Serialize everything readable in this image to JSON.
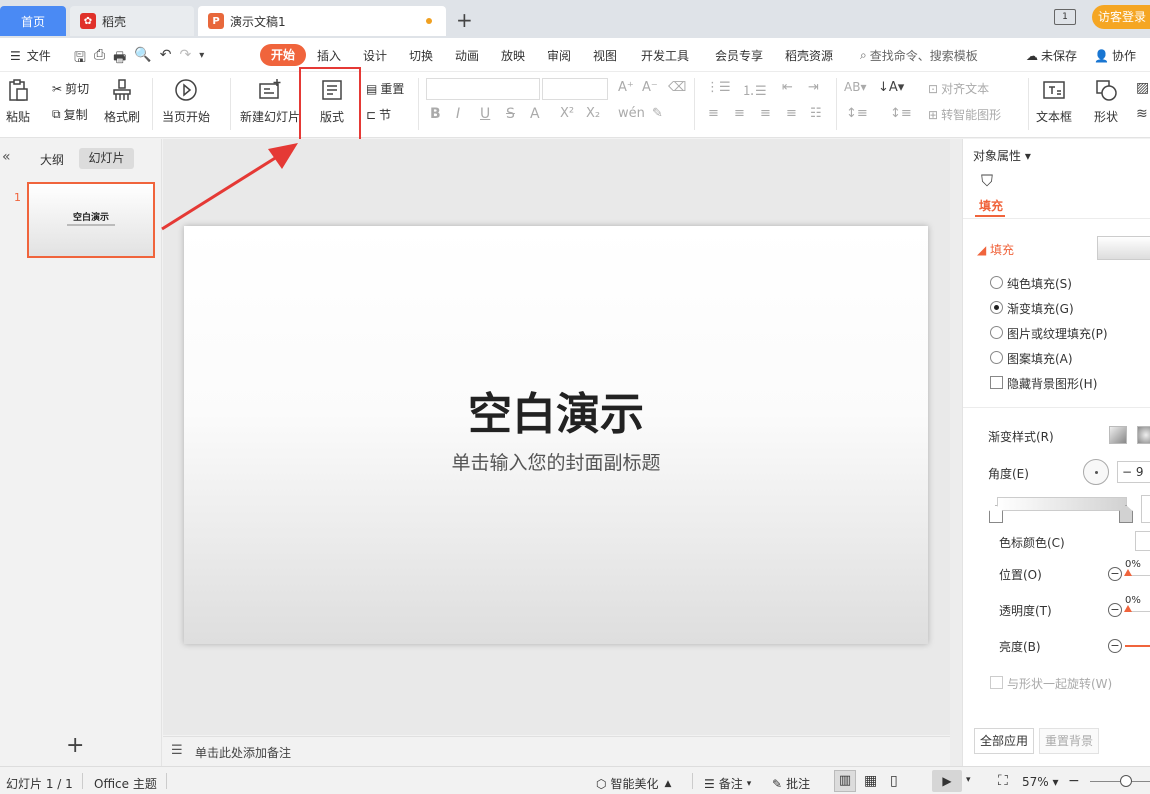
{
  "tabs": {
    "home": "首页",
    "daoke": "稻壳",
    "doc": "演示文稿1",
    "new_tab": "+",
    "guest_login": "访客登录"
  },
  "menu": {
    "file": "文件",
    "items": [
      "开始",
      "插入",
      "设计",
      "切换",
      "动画",
      "放映",
      "审阅",
      "视图",
      "开发工具",
      "会员专享",
      "稻壳资源"
    ],
    "search": "查找命令、搜索模板",
    "unsaved": "未保存",
    "collab": "协作"
  },
  "ribbon": {
    "paste": "粘贴",
    "cut": "剪切",
    "copy": "复制",
    "format_painter": "格式刷",
    "play_from_current": "当页开始",
    "new_slide": "新建幻灯片",
    "layout": "版式",
    "reset": "重置",
    "section": "节",
    "align_text": "对齐文本",
    "smart_shape": "转智能图形",
    "textbox": "文本框",
    "shape": "形状"
  },
  "left_panel": {
    "tab_outline": "大纲",
    "tab_slides": "幻灯片",
    "slide_number": "1",
    "thumb_title": "空白演示",
    "add": "+"
  },
  "slide": {
    "title": "空白演示",
    "subtitle": "单击输入您的封面副标题"
  },
  "notes": {
    "placeholder": "单击此处添加备注"
  },
  "right_panel": {
    "header": "对象属性",
    "tab_fill": "填充",
    "section_fill": "填充",
    "options": [
      "纯色填充(S)",
      "渐变填充(G)",
      "图片或纹理填充(P)",
      "图案填充(A)"
    ],
    "selected_option": "渐变填充(G)",
    "hide_bg": "隐藏背景图形(H)",
    "gradient_style": "渐变样式(R)",
    "angle": "角度(E)",
    "angle_value": "9",
    "stop_color": "色标颜色(C)",
    "position": "位置(O)",
    "position_value": "0%",
    "transparency": "透明度(T)",
    "transparency_value": "0%",
    "brightness": "亮度(B)",
    "rotate_with_shape": "与形状一起旋转(W)",
    "apply_all": "全部应用",
    "reset_bg": "重置背景"
  },
  "status": {
    "slide_count": "幻灯片 1 / 1",
    "theme": "Office 主题",
    "smart_beautify": "智能美化",
    "notes": "备注",
    "comments": "批注",
    "zoom": "57%"
  },
  "colors": {
    "accent": "#f0643c",
    "highlight_box": "#e53935",
    "arrow": "#e53935",
    "home_tab": "#4a8af4"
  }
}
